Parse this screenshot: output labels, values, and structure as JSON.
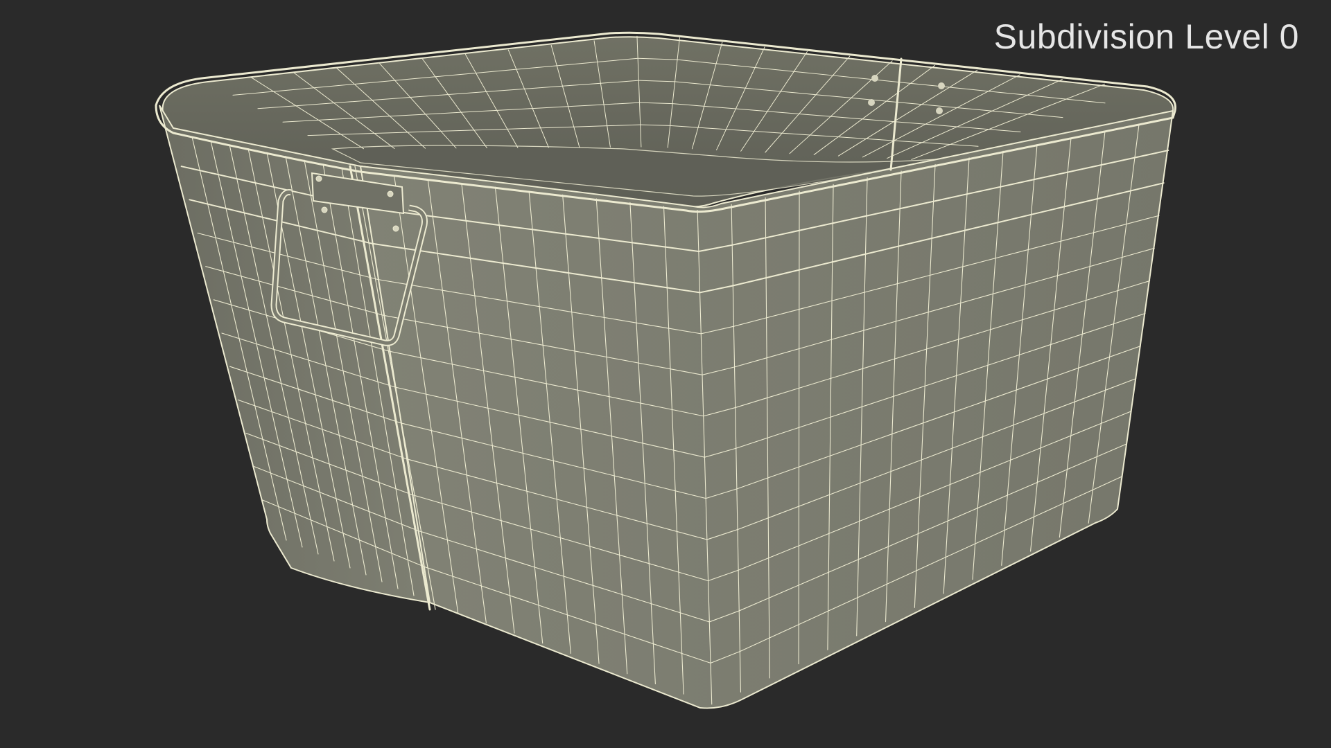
{
  "viewport": {
    "label": "Subdivision Level 0",
    "colors": {
      "background": "#2a2a2a",
      "surface_outer": "#7b7c6f",
      "surface_inner": "#6a6b60",
      "wire": "#ecead0",
      "label_text": "#e6e6e6"
    },
    "model": "square galvanized tub with side handle, wireframe view"
  }
}
